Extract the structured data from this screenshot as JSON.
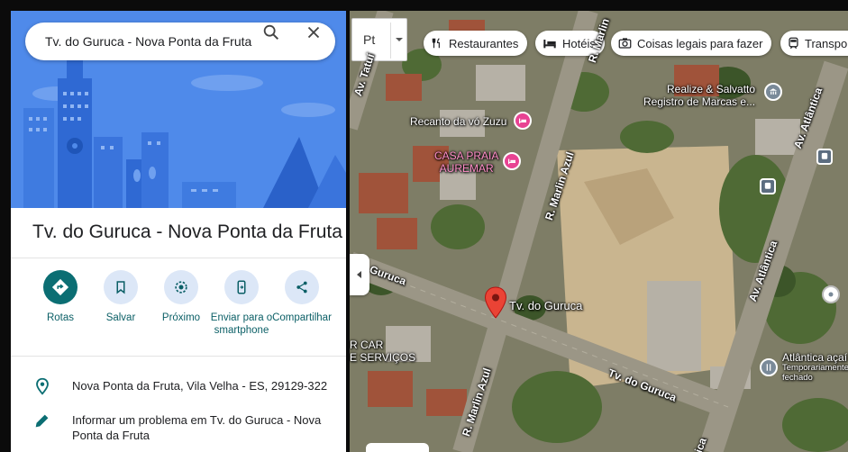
{
  "search": {
    "value": "Tv. do Guruca - Nova Ponta da Fruta"
  },
  "place": {
    "title": "Tv. do Guruca - Nova Ponta da Fruta"
  },
  "actions": [
    {
      "label": "Rotas",
      "icon": "directions-icon"
    },
    {
      "label": "Salvar",
      "icon": "bookmark-icon"
    },
    {
      "label": "Próximo",
      "icon": "nearby-icon"
    },
    {
      "label": "Enviar para o smartphone",
      "icon": "send-to-phone-icon"
    },
    {
      "label": "Compartilhar",
      "icon": "share-icon"
    }
  ],
  "info": {
    "address": "Nova Ponta da Fruta, Vila Velha - ES, 29129-322",
    "report": "Informar um problema em Tv. do Guruca - Nova Ponta da Fruta"
  },
  "map": {
    "layer_label": "Pt",
    "chips": [
      {
        "label": "Restaurantes",
        "icon": "restaurant-icon"
      },
      {
        "label": "Hotéis",
        "icon": "hotel-icon"
      },
      {
        "label": "Coisas legais para fazer",
        "icon": "camera-icon"
      },
      {
        "label": "Transpo",
        "icon": "transit-icon"
      }
    ],
    "pin_label": "Tv. do Guruca",
    "roads": {
      "guruca_left": "Guruca",
      "guruca_right": "Tv. do Guruca",
      "marlin_top": "R. Marlin Azul",
      "marlin_bottom": "R. Marlin Azul",
      "atlantica_top": "Av. Atlântica",
      "atlantica_mid": "Av. Atlântica",
      "atlantica_bottom": "ica",
      "tatui": "Av. Tatuí",
      "marlin_far": "R. Marlin"
    },
    "pois": {
      "recanto": "Recanto da vó Zuzu",
      "casa_line1": "CASA PRAIA",
      "casa_line2": "AUREMAR",
      "realize_line1": "Realize & Salvatto",
      "realize_line2": "Registro de Marcas e...",
      "car_line1": "R CAR",
      "car_line2": "E SERVIÇOS",
      "atlantica_poi": "Atlântica açaí",
      "atlantica_sub1": "Temporariamente",
      "atlantica_sub2": "fechado"
    },
    "colors": {
      "pin": "#ea4335",
      "poi_pink": "#e84393",
      "accent": "#0b6e73"
    }
  }
}
